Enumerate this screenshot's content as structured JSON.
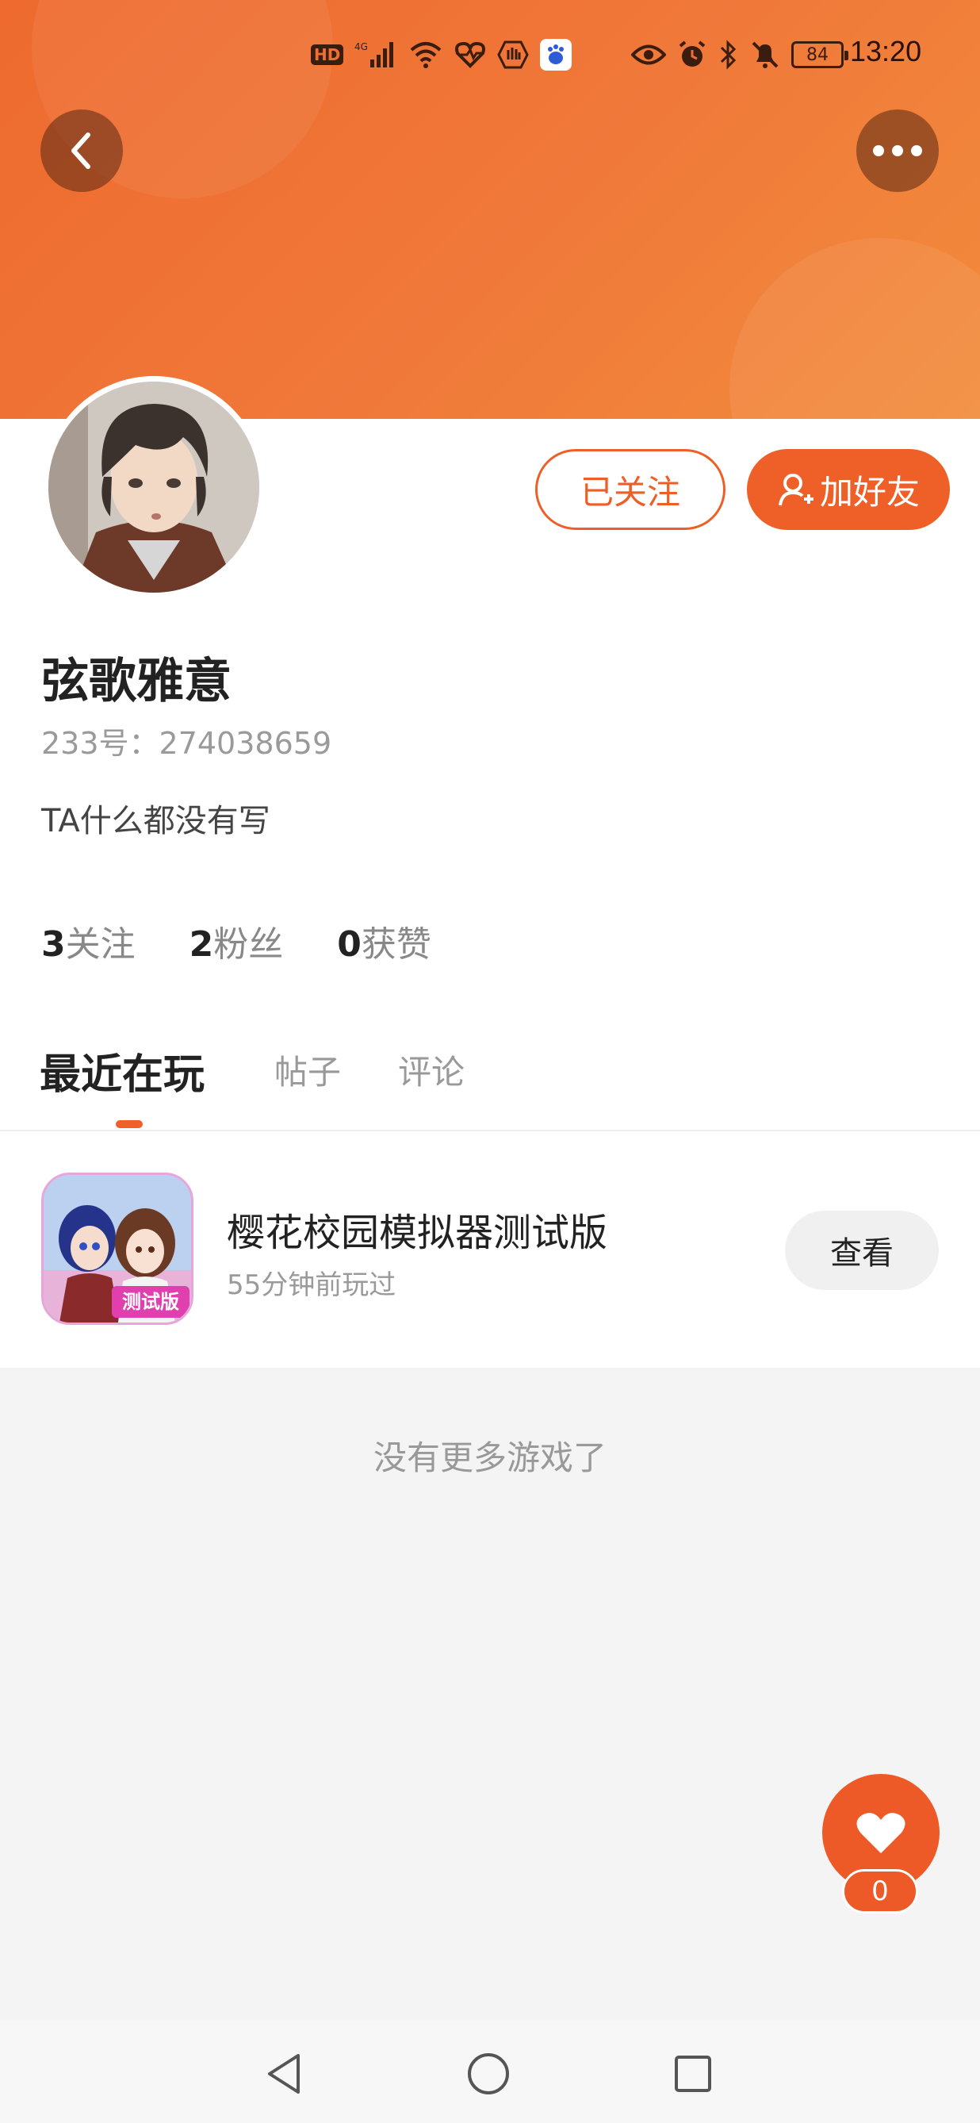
{
  "status_bar": {
    "hd_badge": "HD",
    "network": "4G",
    "battery": "84",
    "time": "13:20"
  },
  "header": {
    "back_icon": "chevron-left-icon",
    "more_icon": "more-horizontal-icon"
  },
  "profile": {
    "nickname": "弦歌雅意",
    "uid": "233号：274038659",
    "bio": "TA什么都没有写",
    "followed_button": "已关注",
    "add_friend_button": "加好友",
    "stats": [
      {
        "num": "3",
        "label": "关注"
      },
      {
        "num": "2",
        "label": "粉丝"
      },
      {
        "num": "0",
        "label": "获赞"
      }
    ]
  },
  "tabs": [
    {
      "label": "最近在玩",
      "active": true
    },
    {
      "label": "帖子",
      "active": false
    },
    {
      "label": "评论",
      "active": false
    }
  ],
  "recent_games": [
    {
      "title": "樱花校园模拟器测试版",
      "subtitle": "55分钟前玩过",
      "icon_badge": "测试版",
      "action": "查看"
    }
  ],
  "footer_text": "没有更多游戏了",
  "like_fab": {
    "count": "0",
    "icon": "heart-icon"
  },
  "colors": {
    "accent": "#ef5f28",
    "header_gradient_start": "#ee6a2e",
    "header_gradient_end": "#f28c3c"
  }
}
